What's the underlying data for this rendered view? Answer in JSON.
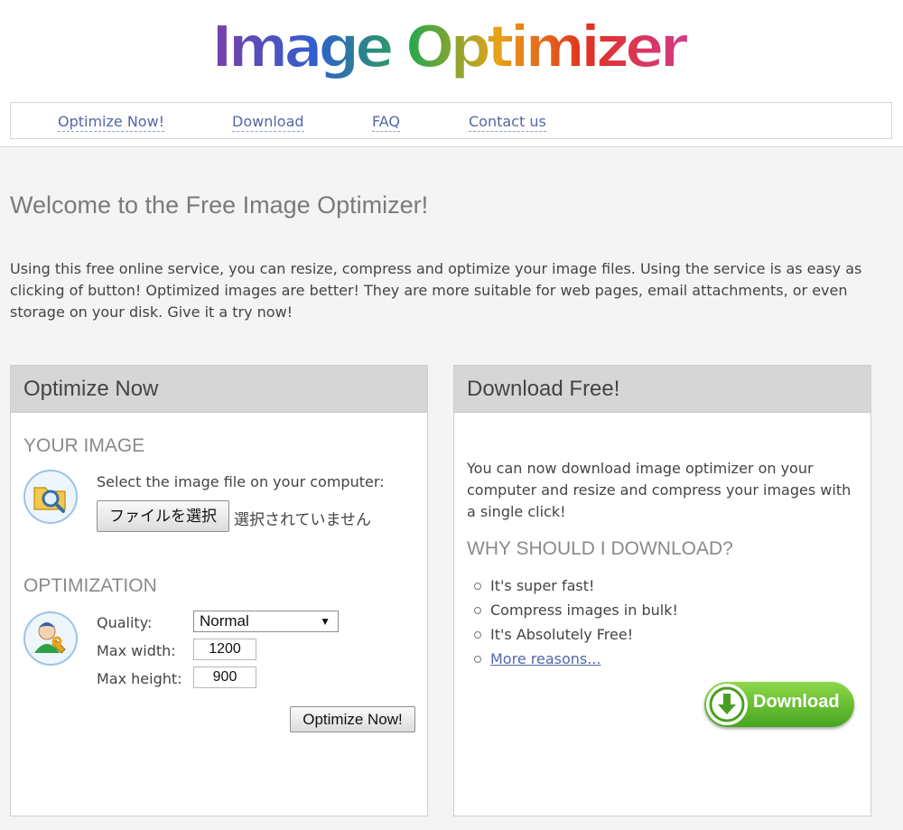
{
  "logo": {
    "text": "Image Optimizer"
  },
  "nav": {
    "items": [
      {
        "label": "Optimize Now!"
      },
      {
        "label": "Download"
      },
      {
        "label": "FAQ"
      },
      {
        "label": "Contact us"
      }
    ],
    "link_color": "#5267a8"
  },
  "welcome": {
    "title": "Welcome to the Free Image Optimizer!",
    "intro": "Using this free online service, you can resize, compress and optimize your image files. Using the service is as easy as clicking of button! Optimized images are better! They are more suitable for web pages, email attachments, or even storage on your disk. Give it a try now!"
  },
  "optimize_panel": {
    "title": "Optimize Now",
    "your_image": {
      "heading": "YOUR IMAGE",
      "icon": "folder-search-icon",
      "prompt": "Select the image file on your computer:",
      "file_button": "ファイルを選択",
      "file_status": "選択されていません"
    },
    "optimization": {
      "heading": "OPTIMIZATION",
      "icon": "user-settings-icon",
      "quality_label": "Quality:",
      "quality_value": "Normal",
      "max_width_label": "Max width:",
      "max_width_value": "1200",
      "max_height_label": "Max height:",
      "max_height_value": "900"
    },
    "submit_button": "Optimize Now!"
  },
  "download_panel": {
    "title": "Download Free!",
    "description": "You can now download image optimizer on your computer and resize and compress your images with a single click!",
    "why_heading": "WHY SHOULD I DOWNLOAD?",
    "reasons": [
      {
        "text": "It's super fast!"
      },
      {
        "text": "Compress images in bulk!"
      },
      {
        "text": "It's Absolutely Free!"
      }
    ],
    "more_link": "More reasons...",
    "download_button": "Download",
    "download_icon": "down-arrow-icon",
    "button_color": "#5fbf2b"
  }
}
